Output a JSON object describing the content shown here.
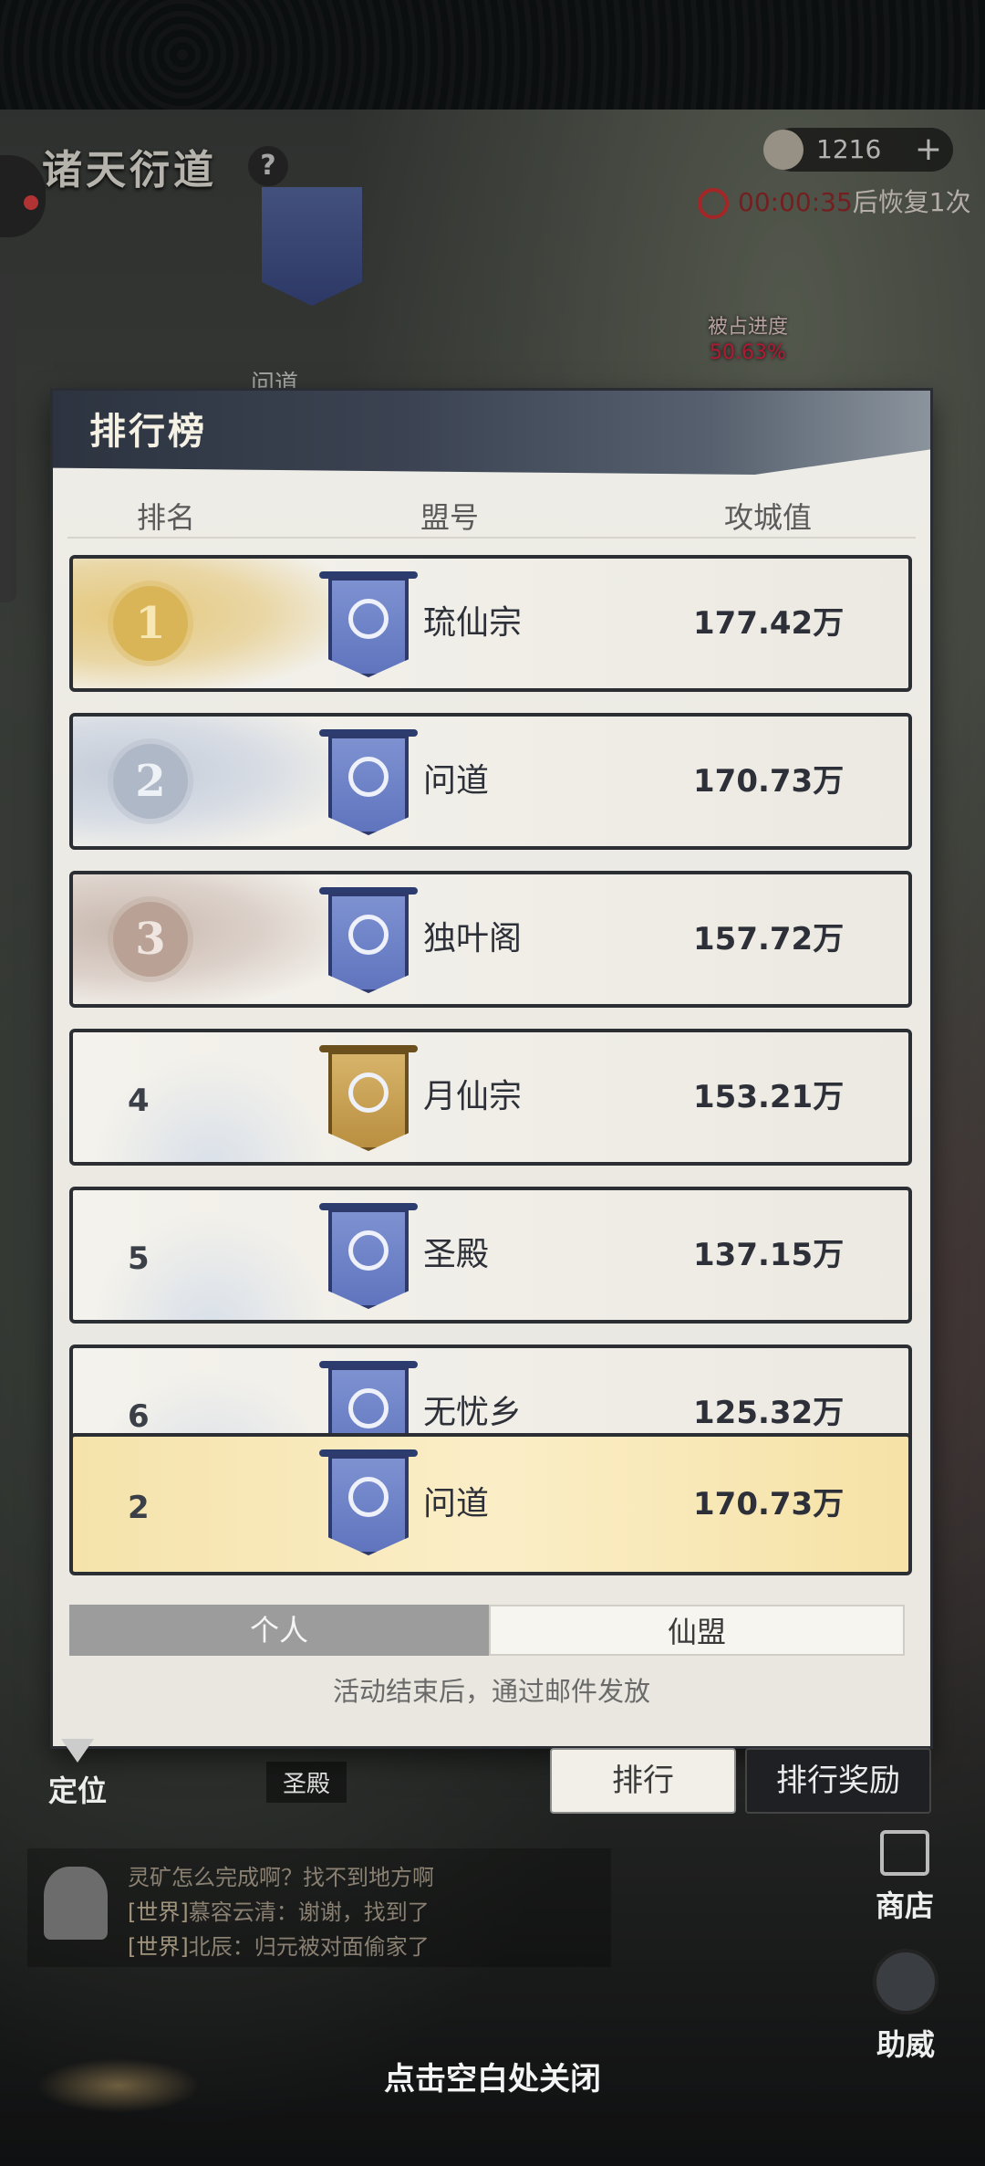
{
  "hud": {
    "game_title": "诸天衍道",
    "help_label": "?",
    "currency_value": "1216",
    "currency_plus": "+",
    "recover_timer": "00:00:35",
    "recover_text": "后恢复1次",
    "occupy_label": "被占进度",
    "occupy_pct": "50.63%",
    "map_tag_top": "问道",
    "map_tag_bottom": "圣殿"
  },
  "panel": {
    "title": "排行榜",
    "columns": {
      "rank": "排名",
      "name": "盟号",
      "score": "攻城值"
    },
    "rows": [
      {
        "rank": "1",
        "name": "琉仙宗",
        "score": "177.42万"
      },
      {
        "rank": "2",
        "name": "问道",
        "score": "170.73万"
      },
      {
        "rank": "3",
        "name": "独叶阁",
        "score": "157.72万"
      },
      {
        "rank": "4",
        "name": "月仙宗",
        "score": "153.21万"
      },
      {
        "rank": "5",
        "name": "圣殿",
        "score": "137.15万"
      },
      {
        "rank": "6",
        "name": "无忧乡",
        "score": "125.32万"
      }
    ],
    "my_row": {
      "rank": "2",
      "name": "问道",
      "score": "170.73万"
    },
    "tabs": {
      "personal": "个人",
      "alliance": "仙盟"
    },
    "notice": "活动结束后，通过邮件发放"
  },
  "bottom": {
    "locate": "定位",
    "rank_button": "排行",
    "reward_button": "排行奖励",
    "shop": "商店",
    "help": "助威",
    "chat": [
      {
        "who": "",
        "text": "灵矿怎么完成啊？找不到地方啊"
      },
      {
        "who": "[世界]",
        "text": "慕容云清：谢谢，找到了"
      },
      {
        "who": "[世界]",
        "text": "北辰：归元被对面偷家了"
      }
    ],
    "close_hint": "点击空白处关闭"
  }
}
